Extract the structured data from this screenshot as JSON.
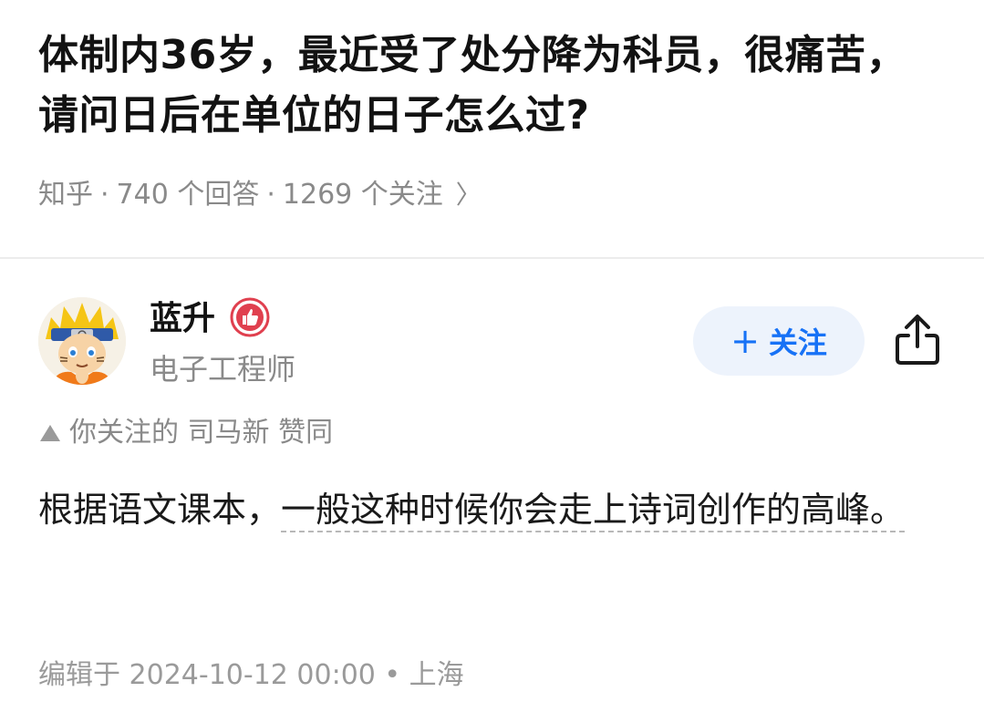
{
  "question": {
    "title": "体制内36岁，最近受了处分降为科员，很痛苦，请问日后在单位的日子怎么过?",
    "source": "知乎",
    "sep": "·",
    "answers": "740 个回答",
    "followers": "1269 个关注",
    "chevron": "〉"
  },
  "author": {
    "name": "蓝升",
    "title": "电子工程师",
    "avatar_icon": "avatar-naruto",
    "badge_icon": "thumbs-up-badge-icon"
  },
  "actions": {
    "follow_plus": "+",
    "follow_label": "关注",
    "share_icon": "share-icon"
  },
  "social": {
    "text": "你关注的 司马新 赞同"
  },
  "answer": {
    "plain": "根据语文课本，",
    "underlined": "一般这种时候你会走上诗词创作的高峰。"
  },
  "footer": {
    "edited": "编辑于 2024-10-12 00:00",
    "dot": "•",
    "location": "上海"
  },
  "colors": {
    "accent": "#1772f6",
    "follow_bg": "#edf3fc",
    "badge": "#e0404f",
    "meta_gray": "#8a8a8a"
  }
}
